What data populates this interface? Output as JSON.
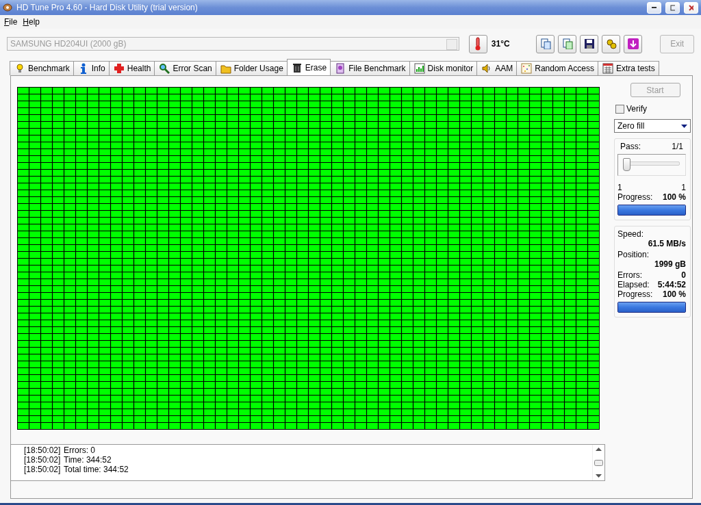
{
  "window": {
    "title": "HD Tune Pro 4.60 - Hard Disk Utility (trial version)"
  },
  "menu": [
    {
      "label": "File",
      "mnemonic": true
    },
    {
      "label": "Help",
      "mnemonic": true
    }
  ],
  "drive_select": {
    "value": "SAMSUNG HD204UI (2000 gB)",
    "disabled": true
  },
  "temperature": "31°C",
  "exit_button": {
    "label": "Exit",
    "disabled": true
  },
  "tabs": [
    {
      "label": "Benchmark",
      "selected": false
    },
    {
      "label": "Info",
      "selected": false
    },
    {
      "label": "Health",
      "selected": false
    },
    {
      "label": "Error Scan",
      "selected": false
    },
    {
      "label": "Folder Usage",
      "selected": false
    },
    {
      "label": "Erase",
      "selected": true
    },
    {
      "label": "File Benchmark",
      "selected": false
    },
    {
      "label": "Disk monitor",
      "selected": false
    },
    {
      "label": "AAM",
      "selected": false
    },
    {
      "label": "Random Access",
      "selected": false
    },
    {
      "label": "Extra tests",
      "selected": false
    }
  ],
  "start_button": {
    "label": "Start",
    "disabled": true
  },
  "verify": {
    "label": "Verify",
    "checked": false
  },
  "method": {
    "value": "Zero fill"
  },
  "pass_panel": {
    "label": "Pass:",
    "value": "1/1",
    "slider": {
      "level": 0
    },
    "min": "1",
    "max": "1",
    "progress_label": "Progress:",
    "progress_value": "100 %",
    "progress": {
      "level": 1
    }
  },
  "stats": [
    {
      "label": "Speed:",
      "value": "61.5 MB/s",
      "kind": "stacked"
    },
    {
      "label": "Position:",
      "value": "1999 gB",
      "kind": "stacked"
    },
    {
      "label": "Errors:",
      "value": "0",
      "kind": "inline"
    },
    {
      "label": "Elapsed:",
      "value": "5:44:52",
      "kind": "inline"
    },
    {
      "label": "Progress:",
      "value": "100 %",
      "kind": "inline"
    }
  ],
  "stats_progress": {
    "level": 1
  },
  "log": [
    {
      "time": "[18:50:02]",
      "message": "Errors: 0"
    },
    {
      "time": "[18:50:02]",
      "message": "Time: 344:52"
    },
    {
      "time": "[18:50:02]",
      "message": "Total time: 344:52"
    }
  ]
}
